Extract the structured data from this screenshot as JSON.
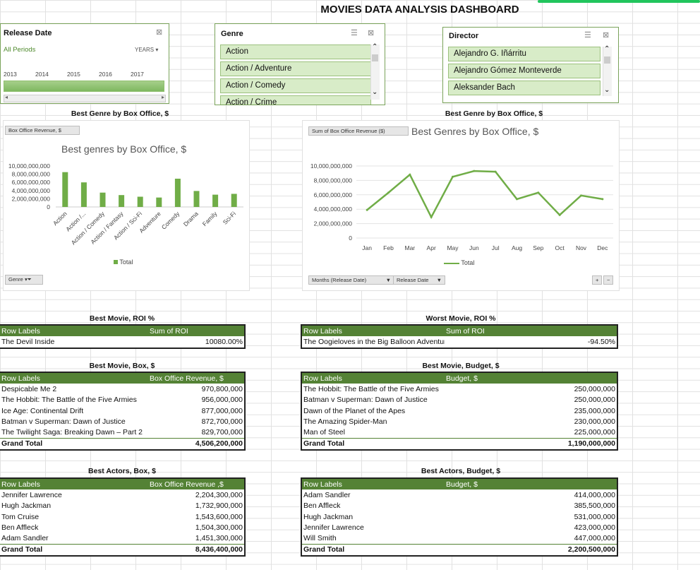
{
  "title": "MOVIES DATA ANALYSIS DASHBOARD",
  "timeline": {
    "header": "Release Date",
    "period_label": "All Periods",
    "level_label": "YEARS",
    "years": [
      "2013",
      "2014",
      "2015",
      "2016",
      "2017"
    ]
  },
  "genre_slicer": {
    "header": "Genre",
    "items": [
      "Action",
      "Action / Adventure",
      "Action / Comedy",
      "Action / Crime"
    ]
  },
  "director_slicer": {
    "header": "Director",
    "items": [
      "Alejandro G. Iñárritu",
      "Alejandro Gómez Monteverde",
      "Aleksander Bach"
    ]
  },
  "chart_left": {
    "section_title": "Best Genre by Box Office, $",
    "field_button": "Box Office Revenue, $",
    "title": "Best genres by Box Office, $",
    "legend": "Total",
    "filter_button": "Genre"
  },
  "chart_right": {
    "section_title": "Best Genre by Box Office, $",
    "field_button": "Sum of Box Office Revenue ($)",
    "title": "Best Genres by Box Office, $",
    "legend": "Total",
    "filter_months": "Months (Release Date)",
    "filter_release": "Release Date",
    "plus": "+",
    "minus": "−"
  },
  "chart_data": [
    {
      "type": "bar",
      "title": "Best genres by Box Office, $",
      "categories": [
        "Action",
        "Action /...",
        "Action / Comedy",
        "Action / Fantasy",
        "Action / Sci-Fi",
        "Adventure",
        "Comedy",
        "Drama",
        "Family",
        "Sci-Fi"
      ],
      "series": [
        {
          "name": "Total",
          "values": [
            8500000000,
            6000000000,
            3500000000,
            2900000000,
            2500000000,
            2300000000,
            6900000000,
            3900000000,
            3000000000,
            3200000000
          ]
        }
      ],
      "yticks": [
        "10,000,000,000",
        "8,000,000,000",
        "6,000,000,000",
        "4,000,000,000",
        "2,000,000,000",
        "0"
      ],
      "ylim": [
        0,
        10000000000
      ],
      "color": "#70ad47"
    },
    {
      "type": "line",
      "title": "Best Genres by Box Office, $",
      "categories": [
        "Jan",
        "Feb",
        "Mar",
        "Apr",
        "May",
        "Jun",
        "Jul",
        "Aug",
        "Sep",
        "Oct",
        "Nov",
        "Dec"
      ],
      "series": [
        {
          "name": "Total",
          "values": [
            3900000000,
            6300000000,
            8800000000,
            2900000000,
            8500000000,
            9300000000,
            9200000000,
            5400000000,
            6300000000,
            3200000000,
            5900000000,
            5400000000
          ]
        }
      ],
      "yticks": [
        "10,000,000,000",
        "8,000,000,000",
        "6,000,000,000",
        "4,000,000,000",
        "2,000,000,000",
        "0"
      ],
      "ylim": [
        0,
        10000000000
      ],
      "color": "#70ad47"
    }
  ],
  "tables": {
    "best_roi": {
      "title": "Best Movie, ROI %",
      "headers": [
        "Row Labels",
        "Sum of ROI"
      ],
      "rows": [
        [
          "The Devil Inside",
          "10080.00%"
        ]
      ]
    },
    "worst_roi": {
      "title": "Worst Movie, ROI %",
      "headers": [
        "Row Labels",
        "Sum of ROI"
      ],
      "rows": [
        [
          "The Oogieloves in the Big Balloon Adventure",
          "-94.50%"
        ]
      ]
    },
    "best_box": {
      "title": "Best Movie, Box, $",
      "headers": [
        "Row Labels",
        "Box Office Revenue, $"
      ],
      "rows": [
        [
          "Despicable Me 2",
          "970,800,000"
        ],
        [
          "The Hobbit: The Battle of the Five Armies",
          "956,000,000"
        ],
        [
          "Ice Age: Continental Drift",
          "877,000,000"
        ],
        [
          "Batman v Superman: Dawn of Justice",
          "872,700,000"
        ],
        [
          "The Twilight Saga: Breaking Dawn – Part 2",
          "829,700,000"
        ]
      ],
      "total": [
        "Grand Total",
        "4,506,200,000"
      ]
    },
    "best_budget": {
      "title": "Best Movie, Budget, $",
      "headers": [
        "Row Labels",
        "Budget, $"
      ],
      "rows": [
        [
          "The Hobbit: The Battle of the Five Armies",
          "250,000,000"
        ],
        [
          "Batman v Superman: Dawn of Justice",
          "250,000,000"
        ],
        [
          "Dawn of the Planet of the Apes",
          "235,000,000"
        ],
        [
          "The Amazing Spider-Man",
          "230,000,000"
        ],
        [
          "Man of Steel",
          "225,000,000"
        ]
      ],
      "total": [
        "Grand Total",
        "1,190,000,000"
      ]
    },
    "actors_box": {
      "title": "Best Actors, Box, $",
      "headers": [
        "Row Labels",
        "Box Office Revenue ,$"
      ],
      "rows": [
        [
          "Jennifer Lawrence",
          "2,204,300,000"
        ],
        [
          "Hugh Jackman",
          "1,732,900,000"
        ],
        [
          "Tom Cruise",
          "1,543,600,000"
        ],
        [
          "Ben Affleck",
          "1,504,300,000"
        ],
        [
          "Adam Sandler",
          "1,451,300,000"
        ]
      ],
      "total": [
        "Grand Total",
        "8,436,400,000"
      ]
    },
    "actors_budget": {
      "title": "Best Actors, Budget, $",
      "headers": [
        "Row Labels",
        "Budget, $"
      ],
      "rows": [
        [
          "Adam Sandler",
          "414,000,000"
        ],
        [
          "Ben Affleck",
          "385,500,000"
        ],
        [
          "Hugh Jackman",
          "531,000,000"
        ],
        [
          "Jennifer Lawrence",
          "423,000,000"
        ],
        [
          "Will Smith",
          "447,000,000"
        ]
      ],
      "total": [
        "Grand Total",
        "2,200,500,000"
      ]
    }
  }
}
